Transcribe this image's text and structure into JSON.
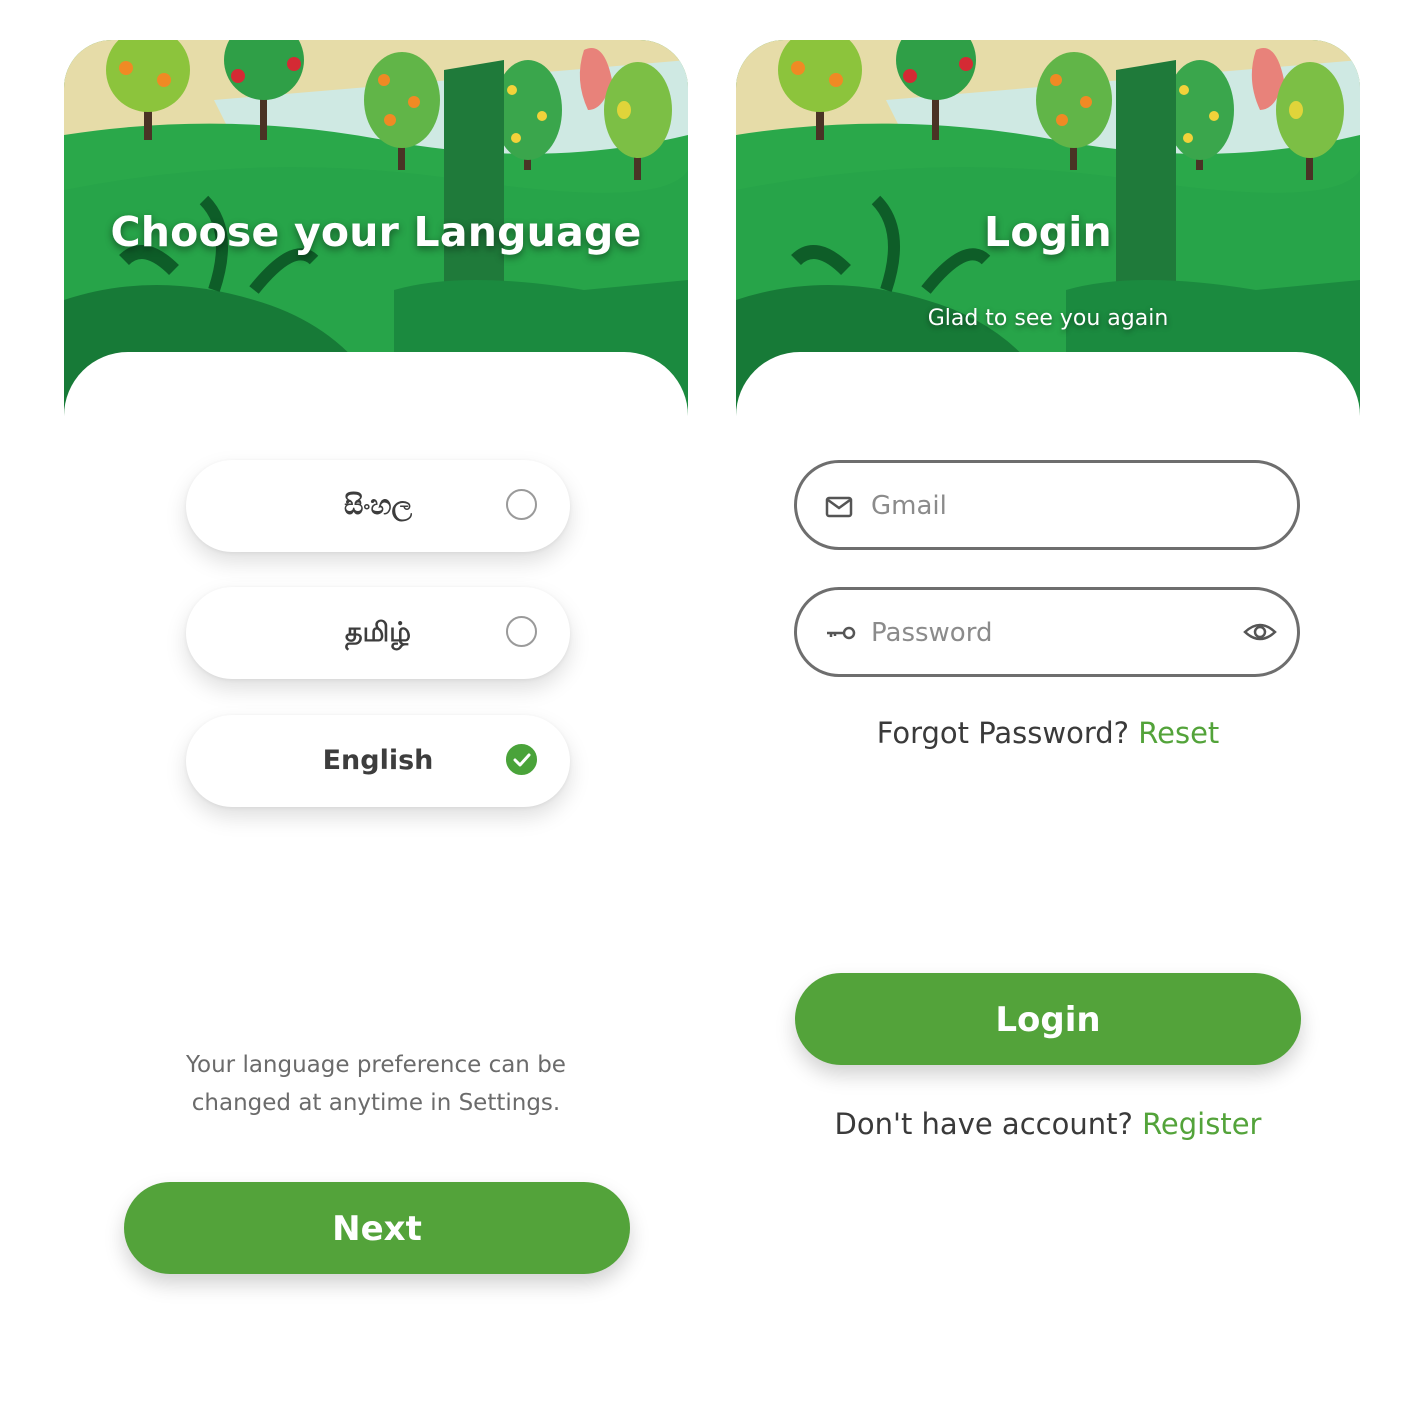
{
  "language_screen": {
    "title": "Choose your Language",
    "options": [
      {
        "label": "සිංහල",
        "selected": false
      },
      {
        "label": "தமிழ்",
        "selected": false
      },
      {
        "label": "English",
        "selected": true
      }
    ],
    "note_line1": "Your language preference can be",
    "note_line2": "changed at anytime in Settings.",
    "next_label": "Next"
  },
  "login_screen": {
    "title": "Login",
    "subtitle": "Glad to see you again",
    "email_placeholder": "Gmail",
    "password_placeholder": "Password",
    "forgot_text": "Forgot Password?",
    "reset_link": "Reset",
    "login_label": "Login",
    "no_account_text": "Don't have account?",
    "register_link": "Register"
  },
  "colors": {
    "accent": "#53a33a",
    "dark_green": "#1f8a3c",
    "text": "#3a3a3a"
  },
  "icons": [
    "mail-icon",
    "key-icon",
    "eye-icon",
    "check-icon"
  ]
}
